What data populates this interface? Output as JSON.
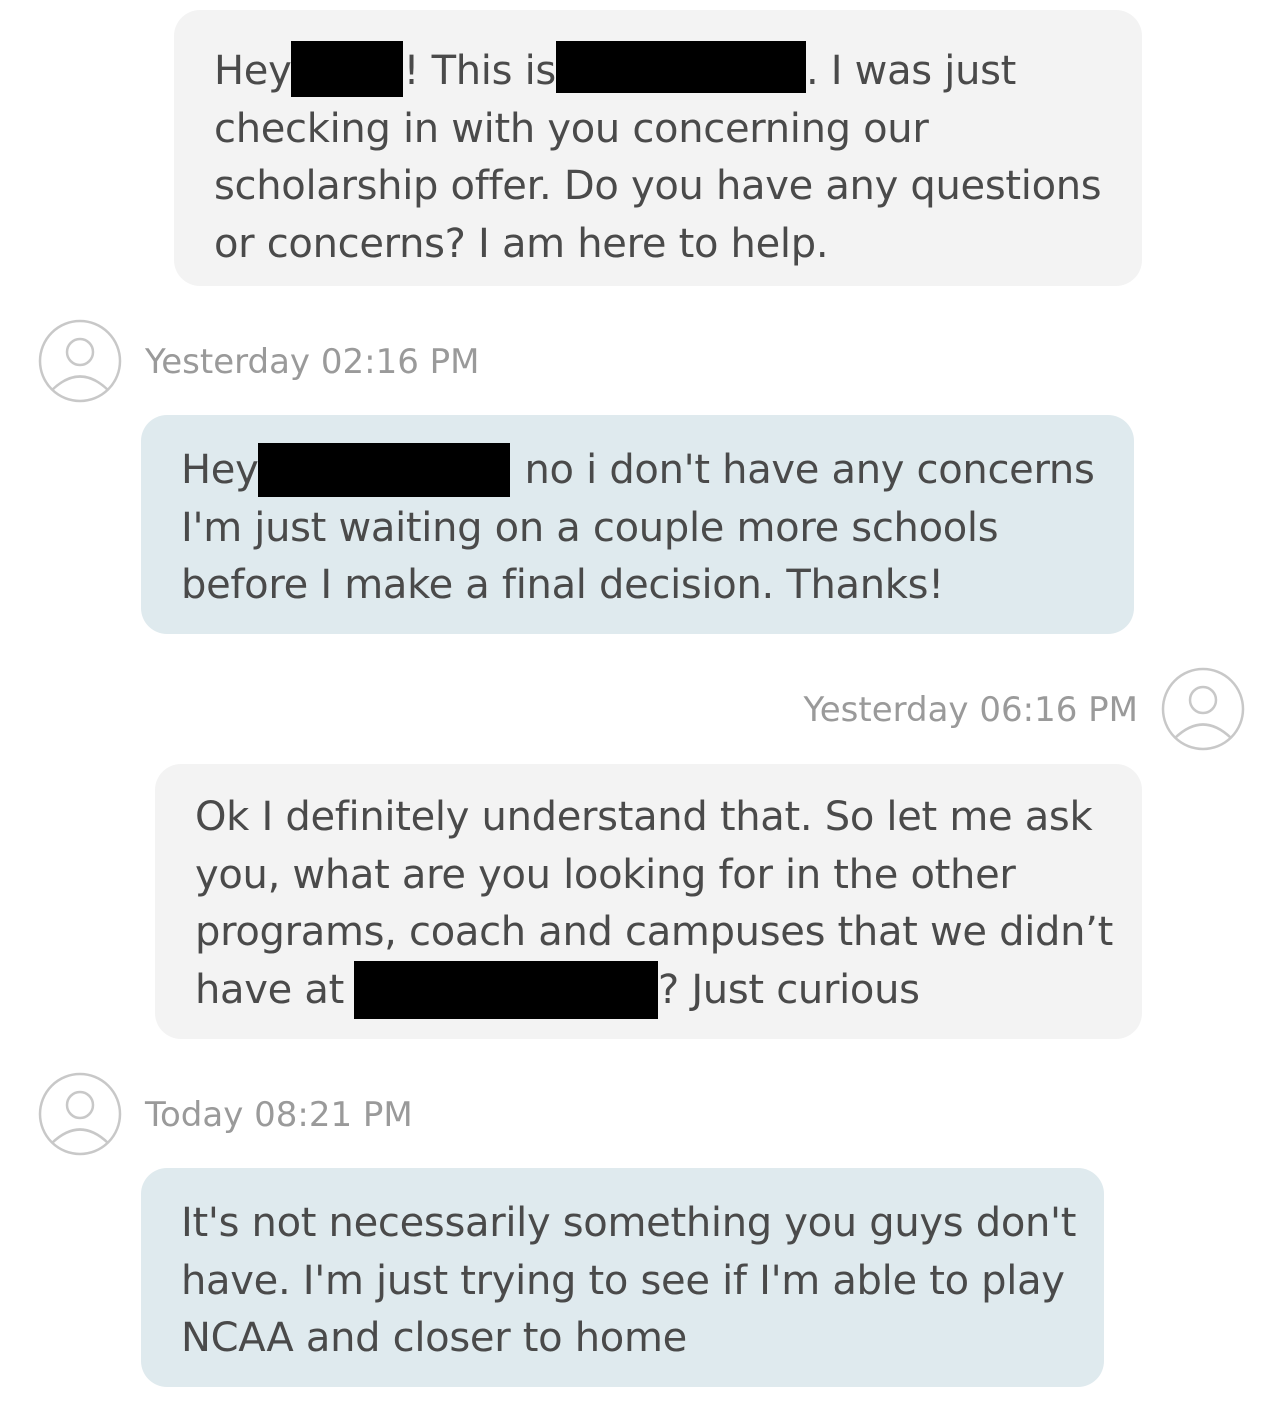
{
  "messages": [
    {
      "direction": "outgoing",
      "lines": [
        {
          "a": "Hey",
          "b": "! This is",
          "c": ". I was just"
        },
        "checking in with you concerning our",
        "scholarship offer. Do you have any questions",
        "or concerns? I am here to help."
      ]
    },
    {
      "direction": "incoming",
      "timestamp": "Yesterday 02:16 PM",
      "lines": [
        {
          "a": "Hey",
          "b": "no i don't have any concerns"
        },
        "I'm just waiting on a couple more schools",
        "before I make a final decision. Thanks!"
      ]
    },
    {
      "direction": "outgoing",
      "timestamp": "Yesterday 06:16 PM",
      "lines": [
        "Ok I definitely understand that.  So let me ask",
        "you, what are you looking for in the other",
        "programs, coach and campuses that we didn’t",
        {
          "a": "have at",
          "b": "? Just curious"
        }
      ]
    },
    {
      "direction": "incoming",
      "timestamp": "Today 08:21 PM",
      "lines": [
        "It's not necessarily something you guys don't",
        "have. I'm just trying to see if I'm able to play",
        "NCAA and closer to home"
      ]
    }
  ],
  "icons": {
    "avatar": "user-avatar-icon"
  },
  "colors": {
    "outgoing_bubble": "#f3f3f3",
    "incoming_bubble": "#dfeaee",
    "text": "#4a4a4a",
    "timestamp": "#9a9a9a",
    "avatar_stroke": "#c8c8c8",
    "redaction": "#000000"
  }
}
